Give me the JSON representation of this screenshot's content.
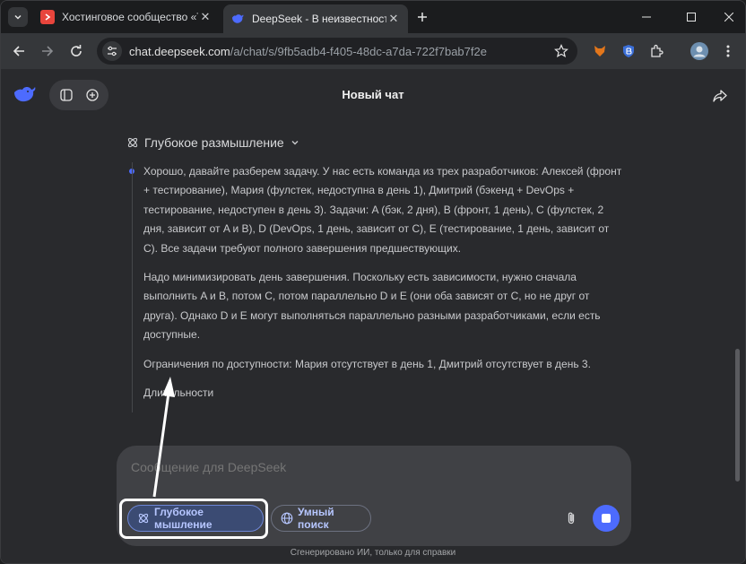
{
  "browser": {
    "tabs": [
      {
        "title": "Хостинговое сообщество «Tim",
        "active": false,
        "favicon_color": "#e8453c"
      },
      {
        "title": "DeepSeek - В неизвестность",
        "active": true,
        "favicon_color": "#4d6bfe"
      }
    ],
    "close_glyph": "✕",
    "url_host": "chat.deepseek.com",
    "url_path": "/a/chat/s/9fb5adb4-f405-48dc-a7da-722f7bab7f2e"
  },
  "chat": {
    "title": "Новый чат",
    "thinking_label": "Глубокое размышление",
    "thinking_paragraphs": [
      "Хорошо, давайте разберем задачу. У нас есть команда из трех разработчиков: Алексей (фронт + тестирование), Мария (фулстек, недоступна в день 1), Дмитрий (бэкенд + DevOps + тестирование, недоступен в день 3). Задачи: A (бэк, 2 дня), B (фронт, 1 день), C (фулстек, 2 дня, зависит от A и B), D (DevOps, 1 день, зависит от C), E (тестирование, 1 день, зависит от C). Все задачи требуют полного завершения предшествующих.",
      "Надо минимизировать день завершения. Поскольку есть зависимости, нужно сначала выполнить A и B, потом C, потом параллельно D и E (они оба зависят от C, но не друг от друга). Однако D и E могут выполняться параллельно разными разработчиками, если есть доступные.",
      "Ограничения по доступности: Мария отсутствует в день 1, Дмитрий отсутствует в день 3.",
      "Длительности"
    ]
  },
  "composer": {
    "placeholder": "Сообщение для DeepSeek",
    "deep_think_label": "Глубокое мышление",
    "search_label": "Умный поиск"
  },
  "footer": "Сгенерировано ИИ, только для справки",
  "colors": {
    "accent": "#4d6bfe",
    "chip_text": "#b6c6ff",
    "background": "#292a2d"
  }
}
